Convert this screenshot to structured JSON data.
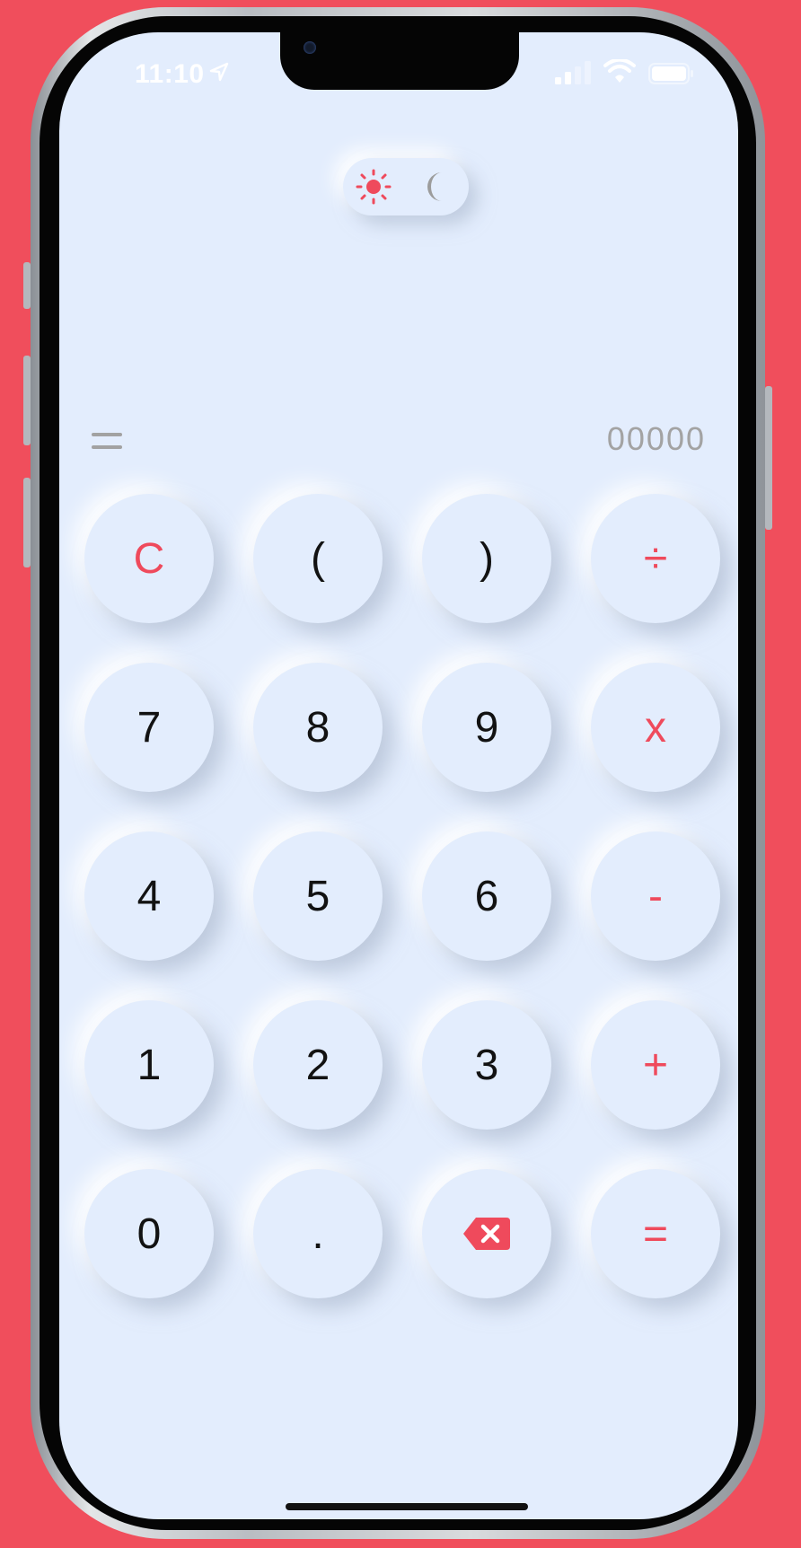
{
  "colors": {
    "background": "#f04e5c",
    "screen": "#e3edfd",
    "accent": "#ef4a5c",
    "digit": "#121212",
    "muted": "#a3a3a3"
  },
  "status_bar": {
    "time": "11:10",
    "icons": [
      "location-arrow-icon",
      "cellular-signal-icon",
      "wifi-icon",
      "battery-icon"
    ]
  },
  "theme_toggle": {
    "options": [
      "sun-icon",
      "moon-icon"
    ],
    "selected": "light"
  },
  "display": {
    "history_icon": "equals-icon",
    "value": "00000"
  },
  "keypad": {
    "rows": [
      [
        {
          "label": "C",
          "name": "clear",
          "accent": true
        },
        {
          "label": "(",
          "name": "open-paren"
        },
        {
          "label": ")",
          "name": "close-paren"
        },
        {
          "label": "÷",
          "name": "divide",
          "accent": true
        }
      ],
      [
        {
          "label": "7",
          "name": "7"
        },
        {
          "label": "8",
          "name": "8"
        },
        {
          "label": "9",
          "name": "9"
        },
        {
          "label": "x",
          "name": "multiply",
          "accent": true
        }
      ],
      [
        {
          "label": "4",
          "name": "4"
        },
        {
          "label": "5",
          "name": "5"
        },
        {
          "label": "6",
          "name": "6"
        },
        {
          "label": "-",
          "name": "subtract",
          "accent": true
        }
      ],
      [
        {
          "label": "1",
          "name": "1"
        },
        {
          "label": "2",
          "name": "2"
        },
        {
          "label": "3",
          "name": "3"
        },
        {
          "label": "+",
          "name": "add",
          "accent": true
        }
      ],
      [
        {
          "label": "0",
          "name": "0"
        },
        {
          "label": ".",
          "name": "decimal"
        },
        {
          "label": "",
          "name": "backspace",
          "icon": "backspace-icon",
          "accent": true
        },
        {
          "label": "=",
          "name": "equals",
          "accent": true
        }
      ]
    ]
  }
}
